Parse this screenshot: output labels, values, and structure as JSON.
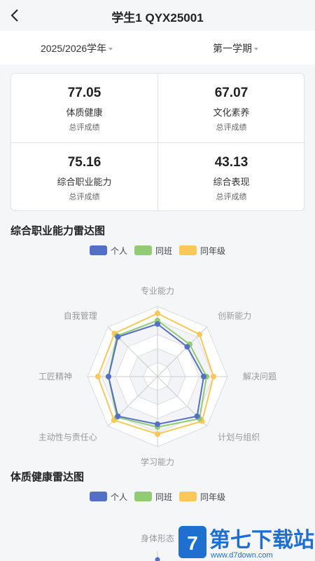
{
  "header": {
    "title": "学生1 QYX25001",
    "back_icon": "chevron-left-icon"
  },
  "filters": {
    "year": "2025/2026学年",
    "term": "第一学期"
  },
  "scores": [
    {
      "value": "77.05",
      "name": "体质健康",
      "sub": "总评成绩"
    },
    {
      "value": "67.07",
      "name": "文化素养",
      "sub": "总评成绩"
    },
    {
      "value": "75.16",
      "name": "综合职业能力",
      "sub": "总评成绩"
    },
    {
      "value": "43.13",
      "name": "综合表现",
      "sub": "总评成绩"
    }
  ],
  "legend": {
    "personal": "个人",
    "class": "同班",
    "grade": "同年级",
    "colors": {
      "personal": "#5470c6",
      "class": "#91cc75",
      "grade": "#fac858"
    }
  },
  "chart_data": [
    {
      "type": "radar",
      "title": "综合职业能力雷达图",
      "indicators": [
        "专业能力",
        "创新能力",
        "解决问题",
        "计划与组织",
        "学习能力",
        "主动性与责任心",
        "工匠精神",
        "自我管理"
      ],
      "max": 100,
      "series": [
        {
          "name": "个人",
          "values": [
            75,
            60,
            66,
            80,
            68,
            80,
            70,
            80
          ]
        },
        {
          "name": "同班",
          "values": [
            80,
            65,
            70,
            85,
            72,
            82,
            70,
            82
          ]
        },
        {
          "name": "同年级",
          "values": [
            90,
            85,
            80,
            90,
            82,
            88,
            85,
            87
          ]
        }
      ]
    },
    {
      "type": "radar",
      "title": "体质健康雷达图",
      "indicators": [
        "身体形态"
      ],
      "series": [
        {
          "name": "个人"
        },
        {
          "name": "同班"
        },
        {
          "name": "同年级"
        }
      ]
    }
  ],
  "watermark": {
    "main": "第七下载站",
    "url": "www.d7down.com"
  }
}
